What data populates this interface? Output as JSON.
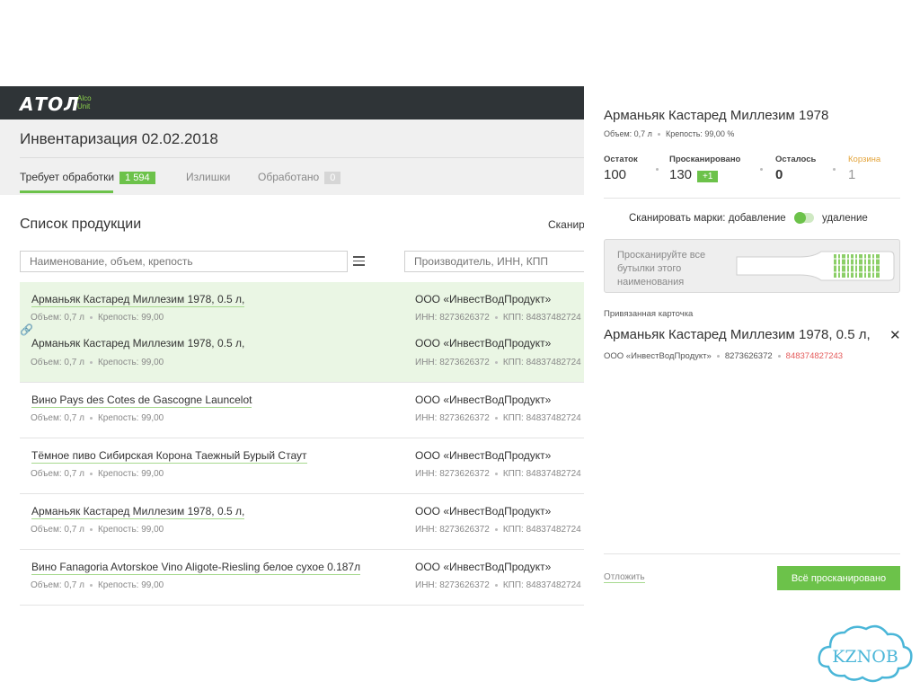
{
  "app": {
    "logo": "АТОЛ",
    "logo_sub_1": "Alco",
    "logo_sub_2": "Unit"
  },
  "header": {
    "title": "Инвентаризация 02.02.2018"
  },
  "tabs": [
    {
      "label": "Требует обработки",
      "badge": "1 594"
    },
    {
      "label": "Излишки"
    },
    {
      "label": "Обработано",
      "badge": "0"
    }
  ],
  "list": {
    "title": "Список продукции",
    "scan_link": "Сканир",
    "search_placeholder": "Наименование, объем, крепость",
    "vendor_placeholder": "Производитель, ИНН, КПП",
    "rows": [
      {
        "name": "Арманьяк Кастаред Миллезим 1978, 0.5 л,",
        "volume": "Объем: 0,7 л",
        "strength": "Крепость: 99,00",
        "vendor": "ООО «ИнвестВодПродукт»",
        "inn": "ИНН: 8273626372",
        "kpp": "КПП: 84837482724"
      },
      {
        "name": "Арманьяк Кастаред Миллезим 1978, 0.5 л,",
        "volume": "Объем: 0,7 л",
        "strength": "Крепость: 99,00",
        "vendor": "ООО «ИнвестВодПродукт»",
        "inn": "ИНН: 8273626372",
        "kpp": "КПП: 84837482724"
      },
      {
        "name": "Вино Pays des Cotes de Gascogne Launcelot",
        "volume": "Объем: 0,7 л",
        "strength": "Крепость: 99,00",
        "vendor": "ООО «ИнвестВодПродукт»",
        "inn": "ИНН: 8273626372",
        "kpp": "КПП: 84837482724"
      },
      {
        "name": "Тёмное пиво Сибирская Корона Таежный Бурый Стаут",
        "volume": "Объем: 0,7 л",
        "strength": "Крепость: 99,00",
        "vendor": "ООО «ИнвестВодПродукт»",
        "inn": "ИНН: 8273626372",
        "kpp": "КПП: 84837482724"
      },
      {
        "name": "Арманьяк Кастаред Миллезим 1978, 0.5 л,",
        "volume": "Объем: 0,7 л",
        "strength": "Крепость: 99,00",
        "vendor": "ООО «ИнвестВодПродукт»",
        "inn": "ИНН: 8273626372",
        "kpp": "КПП: 84837482724"
      },
      {
        "name": "Вино Fanagoria Avtorskoe Vino Aligote-Riesling белое сухое 0.187л",
        "volume": "Объем: 0,7 л",
        "strength": "Крепость: 99,00",
        "vendor": "ООО «ИнвестВодПродукт»",
        "inn": "ИНН: 8273626372",
        "kpp": "КПП: 84837482724"
      }
    ]
  },
  "panel": {
    "title": "Арманьяк Кастаред Миллезим 1978",
    "subtitle_volume": "Объем: 0,7 л",
    "subtitle_strength": "Крепость: 99,00 %",
    "stats": {
      "remaining_label": "Остаток",
      "remaining": "100",
      "scanned_label": "Просканировано",
      "scanned": "130",
      "scanned_delta": "+1",
      "left_label": "Осталось",
      "left": "0",
      "cart_label": "Корзина",
      "cart": "1"
    },
    "scan_mode_label": "Сканировать марки:",
    "scan_mode_add": "добавление",
    "scan_mode_remove": "удаление",
    "scan_hint": "Просканируйте все бутылки этого наименования",
    "attached_label": "Привязанная карточка",
    "attached_name": "Арманьяк Кастаред Миллезим 1978, 0.5 л,",
    "attached_vendor": "ООО «ИнвестВодПродукт»",
    "attached_inn": "8273626372",
    "attached_kpp": "848374827243",
    "postpone": "Отложить",
    "done": "Всё просканировано"
  },
  "watermark": "KZNOB",
  "colors": {
    "accent": "#6cc24a",
    "topbar": "#2f3437",
    "cart": "#e3a43b",
    "kpp_red": "#e45b5b"
  }
}
